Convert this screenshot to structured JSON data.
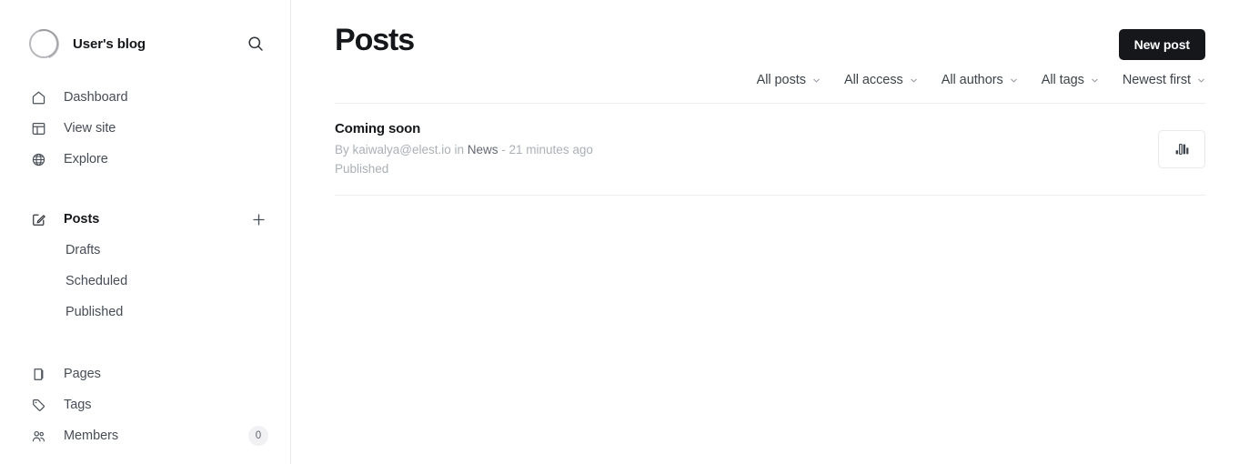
{
  "sidebar": {
    "brand": {
      "title": "User's blog",
      "logo_icon": "circle-ring-logo",
      "search_icon": "search-icon"
    },
    "primary_nav": [
      {
        "label": "Dashboard",
        "icon": "home-icon"
      },
      {
        "label": "View site",
        "icon": "layout-panel-icon"
      },
      {
        "label": "Explore",
        "icon": "globe-icon"
      }
    ],
    "posts_section": {
      "label": "Posts",
      "icon": "pencil-square-icon",
      "add_icon": "plus-icon",
      "sub_items": [
        {
          "label": "Drafts"
        },
        {
          "label": "Scheduled"
        },
        {
          "label": "Published"
        }
      ]
    },
    "secondary_nav": [
      {
        "label": "Pages",
        "icon": "pages-icon",
        "badge": ""
      },
      {
        "label": "Tags",
        "icon": "tag-icon",
        "badge": ""
      },
      {
        "label": "Members",
        "icon": "members-icon",
        "badge": "0"
      }
    ]
  },
  "header": {
    "title": "Posts",
    "new_post_label": "New post"
  },
  "filters": [
    {
      "label": "All posts",
      "chevron_icon": "chevron-down-icon"
    },
    {
      "label": "All access",
      "chevron_icon": "chevron-down-icon"
    },
    {
      "label": "All authors",
      "chevron_icon": "chevron-down-icon"
    },
    {
      "label": "All tags",
      "chevron_icon": "chevron-down-icon"
    },
    {
      "label": "Newest first",
      "chevron_icon": "chevron-down-icon"
    }
  ],
  "posts": [
    {
      "title": "Coming soon",
      "meta_prefix": "By kaiwalya@elest.io in ",
      "meta_tag": "News",
      "meta_suffix": " - 21 minutes ago",
      "status": "Published",
      "stats_icon": "bar-chart-icon"
    }
  ],
  "colors": {
    "accent_dark": "#15171a",
    "text_muted": "#abb0b6",
    "border": "#ebeef0",
    "badge_bg": "#f1f1f3"
  }
}
